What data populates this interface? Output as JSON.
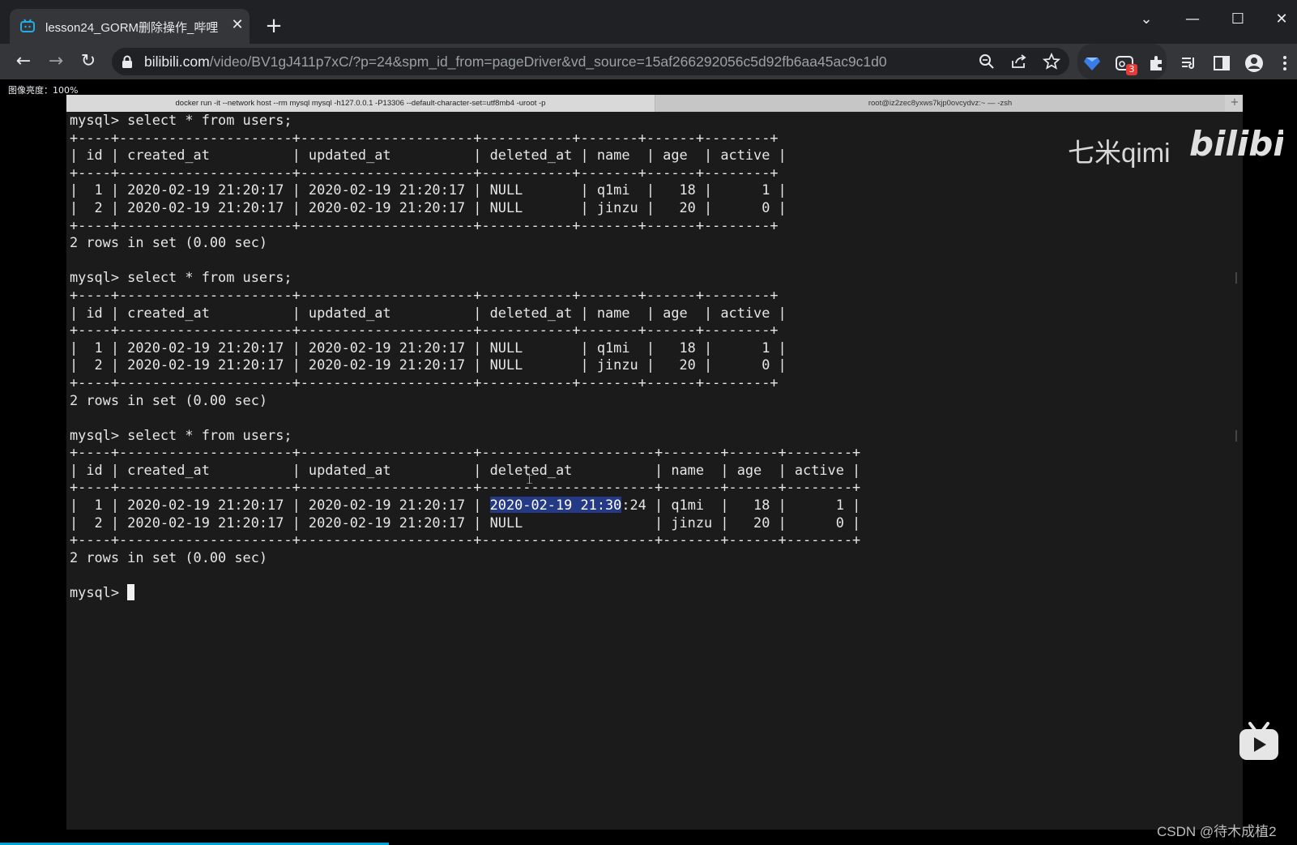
{
  "browser": {
    "tab_title": "lesson24_GORM删除操作_哔哩",
    "tab_close": "✕",
    "new_tab": "+",
    "window_controls": {
      "dropdown": "⌄",
      "minimize": "—",
      "maximize": "☐",
      "close": "✕"
    },
    "nav": {
      "back": "←",
      "forward": "→",
      "reload": "↻"
    },
    "url_host": "bilibili.com",
    "url_path": "/video/BV1gJ411p7xC/?p=24&spm_id_from=pageDriver&vd_source=15af266292056c5d92fb6aa45ac9c1d0",
    "extension_badge": "3",
    "zoom_label": "图像亮度：100%"
  },
  "terminal": {
    "tabs": [
      "docker run -it --network host --rm mysql mysql -h127.0.0.1 -P13306 --default-character-set=utf8mb4 -uroot -p",
      "root@iz2zec8yxws7kjp0ovcydvz:~ — -zsh"
    ],
    "add_tab": "+",
    "lines": [
      "mysql> select * from users;",
      "+----+---------------------+---------------------+-----------+-------+------+--------+",
      "| id | created_at          | updated_at          | deleted_at | name  | age  | active |",
      "+----+---------------------+---------------------+-----------+-------+------+--------+",
      "|  1 | 2020-02-19 21:20:17 | 2020-02-19 21:20:17 | NULL       | q1mi  |   18 |      1 |",
      "|  2 | 2020-02-19 21:20:17 | 2020-02-19 21:20:17 | NULL       | jinzu |   20 |      0 |",
      "+----+---------------------+---------------------+-----------+-------+------+--------+",
      "2 rows in set (0.00 sec)",
      "",
      "mysql> select * from users;",
      "+----+---------------------+---------------------+-----------+-------+------+--------+",
      "| id | created_at          | updated_at          | deleted_at | name  | age  | active |",
      "+----+---------------------+---------------------+-----------+-------+------+--------+",
      "|  1 | 2020-02-19 21:20:17 | 2020-02-19 21:20:17 | NULL       | q1mi  |   18 |      1 |",
      "|  2 | 2020-02-19 21:20:17 | 2020-02-19 21:20:17 | NULL       | jinzu |   20 |      0 |",
      "+----+---------------------+---------------------+-----------+-------+------+--------+",
      "2 rows in set (0.00 sec)",
      "",
      "mysql> select * from users;",
      "+----+---------------------+---------------------+---------------------+-------+------+--------+",
      "| id | created_at          | updated_at          | deleted_at          | name  | age  | active |",
      "+----+---------------------+---------------------+---------------------+-------+------+--------+",
      {
        "pre": "|  1 | 2020-02-19 21:20:17 | 2020-02-19 21:20:17 | ",
        "sel": "2020-02-19 21:30",
        "post": ":24 | q1mi  |   18 |      1 |"
      },
      "|  2 | 2020-02-19 21:20:17 | 2020-02-19 21:20:17 | NULL                | jinzu |   20 |      0 |",
      "+----+---------------------+---------------------+---------------------+-------+------+--------+",
      "2 rows in set (0.00 sec)",
      "",
      {
        "prompt": "mysql> "
      }
    ]
  },
  "watermark": {
    "text": "七米qimi",
    "logo": "bilibili",
    "site_mark": "CSDN @待木成植2"
  },
  "colors": {
    "chrome_bg": "#202124",
    "toolbar_bg": "#35363a",
    "terminal_bg": "#1b1b1b",
    "selection": "#243a86",
    "progress": "#00a1d6"
  },
  "icons": [
    "bilibili-tv-icon",
    "lock-icon",
    "zoom-icon",
    "share-icon",
    "star-icon",
    "extension-icons",
    "profile-icon",
    "menu-icon"
  ]
}
